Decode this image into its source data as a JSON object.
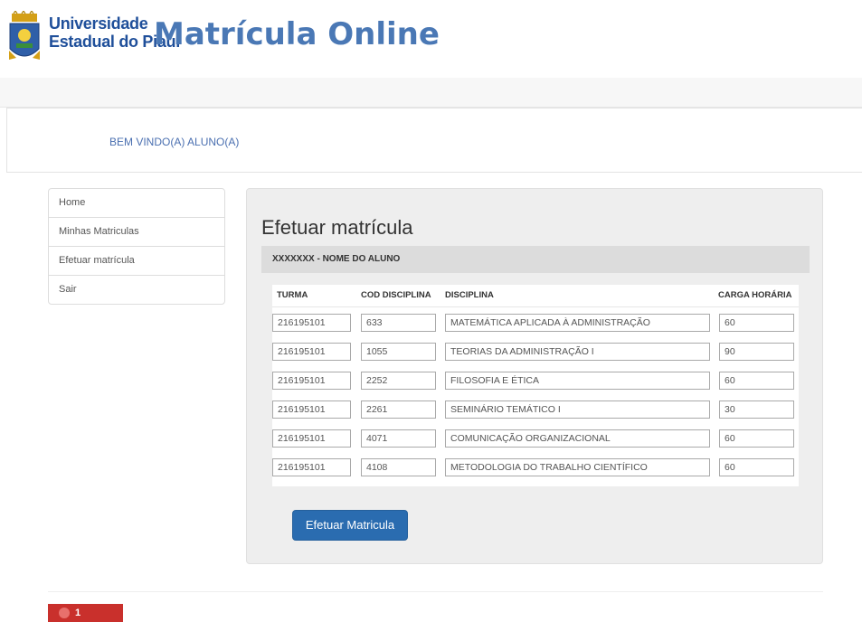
{
  "header": {
    "university_line1": "Universidade",
    "university_line2": "Estadual do Piauí",
    "app_title": "Matrícula Online",
    "logo_icon": "university-crest-icon"
  },
  "welcome": {
    "text": "BEM VINDO(A) ALUNO(A)"
  },
  "sidebar": {
    "items": [
      {
        "label": "Home"
      },
      {
        "label": "Minhas Matriculas"
      },
      {
        "label": "Efetuar matrícula"
      },
      {
        "label": "Sair"
      }
    ]
  },
  "main": {
    "title": "Efetuar matrícula",
    "student": "XXXXXXX - NOME DO ALUNO",
    "columns": [
      "TURMA",
      "COD DISCIPLINA",
      "DISCIPLINA",
      "CARGA HORÁRIA"
    ],
    "rows": [
      {
        "turma": "216195101",
        "cod": "633",
        "disciplina": "MATEMÁTICA APLICADA À ADMINISTRAÇÃO",
        "carga": "60"
      },
      {
        "turma": "216195101",
        "cod": "1055",
        "disciplina": "TEORIAS DA ADMINISTRAÇÃO I",
        "carga": "90"
      },
      {
        "turma": "216195101",
        "cod": "2252",
        "disciplina": "FILOSOFIA E ÉTICA",
        "carga": "60"
      },
      {
        "turma": "216195101",
        "cod": "2261",
        "disciplina": "SEMINÁRIO TEMÁTICO I",
        "carga": "30"
      },
      {
        "turma": "216195101",
        "cod": "4071",
        "disciplina": "COMUNICAÇÃO ORGANIZACIONAL",
        "carga": "60"
      },
      {
        "turma": "216195101",
        "cod": "4108",
        "disciplina": "METODOLOGIA DO TRABALHO CIENTÍFICO",
        "carga": "60"
      }
    ],
    "submit_label": "Efetuar Matricula"
  },
  "footer": {
    "badge_count": "1",
    "badge_icon": "flame-icon"
  },
  "colors": {
    "brand_blue": "#1f4f9a",
    "title_blue": "#4a78b5",
    "button": "#2a6cb0",
    "badge": "#c9302c"
  }
}
